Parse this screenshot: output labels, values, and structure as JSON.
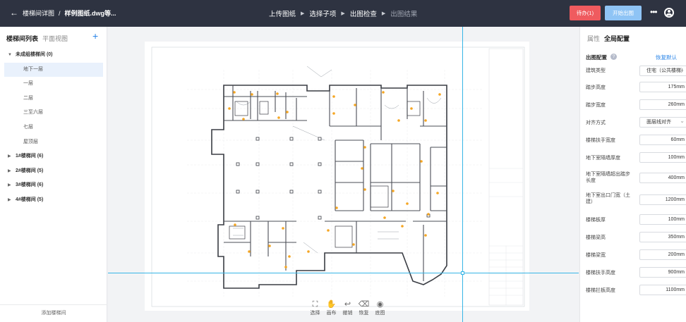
{
  "topbar": {
    "back_icon": "arrow-left-icon",
    "breadcrumb_root": "楼梯间详图",
    "breadcrumb_sep": "/",
    "breadcrumb_current": "样例图纸.dwg等...",
    "steps": [
      "上传图纸",
      "选择子项",
      "出图检查",
      "出图结果"
    ],
    "pending_button": "待办(1)",
    "start_button": "开始出图",
    "more_icon": "more-icon",
    "user_icon": "user-icon",
    "colors": {
      "bar": "#2e3341",
      "red": "#ef5b5f",
      "blue": "#8fc4f5"
    }
  },
  "left_panel": {
    "tab_active": "楼梯间列表",
    "tab_inactive": "平面视图",
    "add_icon": "plus-icon",
    "tree": [
      {
        "label": "未成组楼梯间 (0)",
        "expanded": true,
        "children": [
          "地下一层",
          "一层",
          "二层",
          "三至六层",
          "七层",
          "屋顶层"
        ],
        "selected": "地下一层"
      },
      {
        "label": "1#楼梯间 (6)",
        "expanded": false
      },
      {
        "label": "2#楼梯间 (5)",
        "expanded": false
      },
      {
        "label": "3#楼梯间 (6)",
        "expanded": false
      },
      {
        "label": "4#楼梯间 (5)",
        "expanded": false
      }
    ],
    "add_stair": "添加楼梯间"
  },
  "canvas": {
    "tools": [
      {
        "icon": "select-icon",
        "label": "选择"
      },
      {
        "icon": "hand-icon",
        "label": "画布"
      },
      {
        "icon": "undo-icon",
        "label": "撤销"
      },
      {
        "icon": "restore-icon",
        "label": "恢复"
      },
      {
        "icon": "eye-icon",
        "label": "底图"
      }
    ],
    "guide_color": "#36b5e6"
  },
  "right_panel": {
    "tab_inactive": "属性",
    "tab_active": "全局配置",
    "section_title": "出图配置",
    "help_icon": "help-icon",
    "reset": "恢复默认",
    "props": [
      {
        "label": "建筑类型",
        "value": "住宅（公共楼梯）",
        "type": "select"
      },
      {
        "label": "踏步高度",
        "value": "175mm"
      },
      {
        "label": "踏步宽度",
        "value": "260mm"
      },
      {
        "label": "对齐方式",
        "value": "面层线对齐",
        "type": "select"
      },
      {
        "label": "楼梯扶手宽度",
        "value": "60mm"
      },
      {
        "label": "地下室隔墙厚度",
        "value": "100mm"
      },
      {
        "label": "地下室隔墙超出踏步长度",
        "value": "400mm"
      },
      {
        "label": "地下室出口门宽（土建）",
        "value": "1200mm"
      },
      {
        "label": "楼梯板厚",
        "value": "100mm"
      },
      {
        "label": "楼梯梁高",
        "value": "350mm"
      },
      {
        "label": "楼梯梁宽",
        "value": "200mm"
      },
      {
        "label": "楼梯扶手高度",
        "value": "900mm"
      },
      {
        "label": "楼梯拦板高度",
        "value": "1100mm"
      }
    ]
  }
}
